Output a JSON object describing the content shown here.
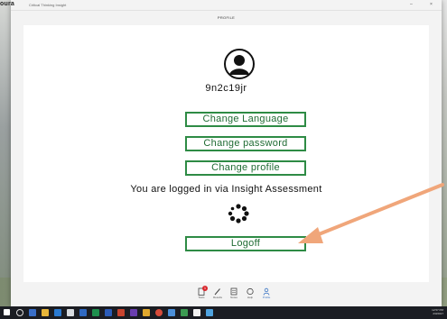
{
  "window": {
    "brand": "oura",
    "app_title": "Critical Thinking Insight",
    "minimize": "–",
    "close": "×"
  },
  "header": {
    "title": "PROFILE"
  },
  "profile": {
    "username": "9n2c19jr",
    "buttons": {
      "change_language": "Change Language",
      "change_password": "Change password",
      "change_profile": "Change profile",
      "logoff": "Logoff"
    },
    "login_info": "You are logged in via Insight Assessment"
  },
  "bottom_nav": {
    "items": [
      {
        "label": "Tests",
        "icon": "clipboard-icon",
        "badge": "1"
      },
      {
        "label": "Results",
        "icon": "pencil-icon"
      },
      {
        "label": "Notes",
        "icon": "notes-icon"
      },
      {
        "label": "Help",
        "icon": "help-icon"
      },
      {
        "label": "Profile",
        "icon": "profile-icon",
        "active": true
      }
    ]
  },
  "taskbar": {
    "time": "12:57 PM",
    "date": "2/3/2017",
    "start_color": "#ffffff"
  },
  "colors": {
    "accent_green": "#2e8b45",
    "active_blue": "#3a74c4",
    "annotation_arrow": "#f0a67a"
  }
}
